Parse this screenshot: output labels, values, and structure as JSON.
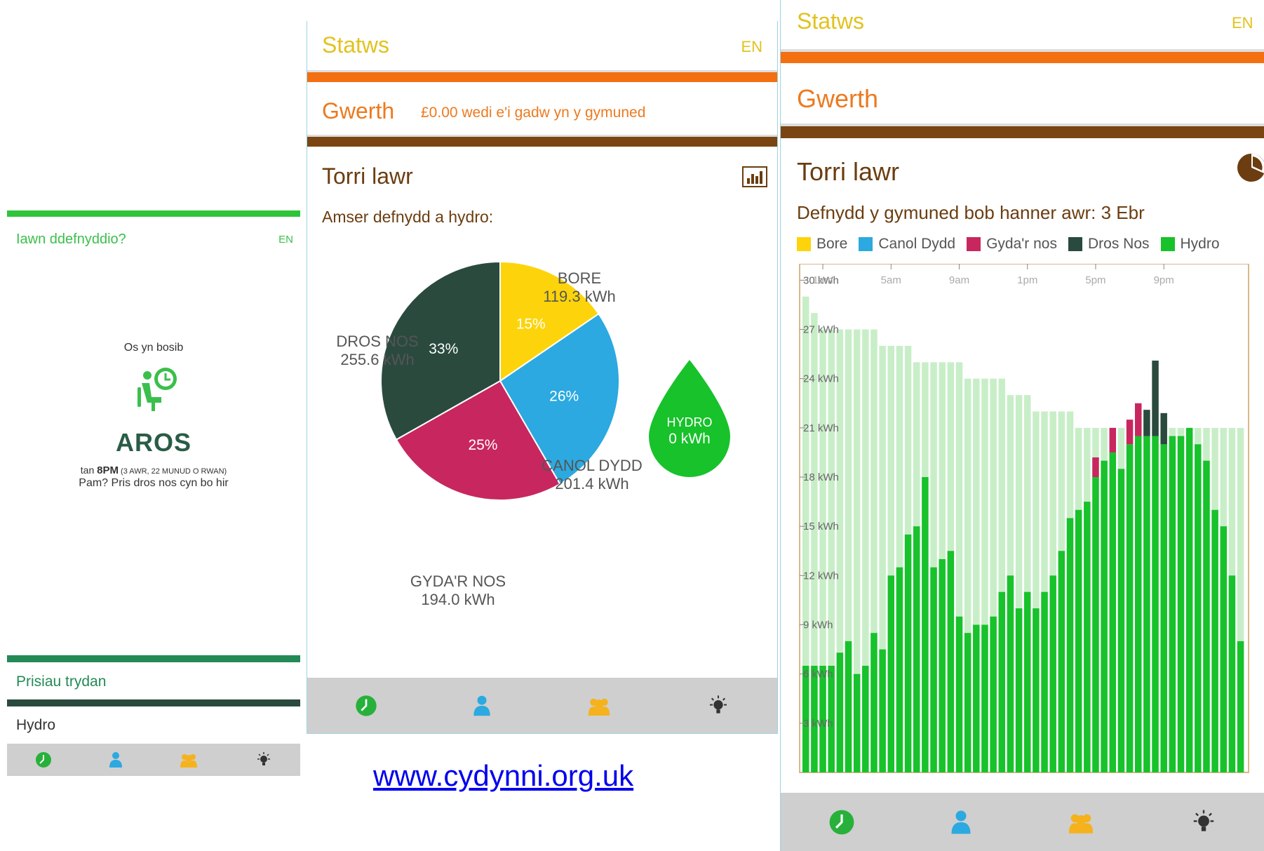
{
  "panel_left": {
    "title": "Iawn ddefnyddio?",
    "lang": "EN",
    "hint": "Os yn bosib",
    "status_word": "AROS",
    "until_prefix": "tan ",
    "until_time": "8PM",
    "until_detail": " (3 AWR, 22 MUNUD O RWAN)",
    "reason": "Pam? Pris dros nos cyn bo hir",
    "prices_label": "Prisiau trydan",
    "hydro_label": "Hydro"
  },
  "panel_middle": {
    "status_title": "Statws",
    "lang": "EN",
    "value_title": "Gwerth",
    "value_text": "£0.00 wedi e'i gadw yn y gymuned",
    "breakdown_title": "Torri lawr",
    "chart_subtitle": "Amser defnydd a hydro:"
  },
  "panel_right": {
    "status_title": "Statws",
    "lang": "EN",
    "value_title": "Gwerth",
    "breakdown_title": "Torri lawr",
    "chart_subtitle": "Defnydd y gymuned bob hanner awr: 3 Ebr"
  },
  "footer_link": "www.cydynni.org.uk",
  "colors": {
    "green": "#2ec53a",
    "yellow": "#e2c21e",
    "orange": "#f36f12",
    "orange_text": "#ec7a1f",
    "brown": "#7a4512",
    "bore": "#fdd40b",
    "canol_dydd": "#2ca9e0",
    "gyda_nos": "#c7275e",
    "dros_nos": "#2a4a3e",
    "hydro": "#17c22b",
    "hydro_light": "#c8eec8"
  },
  "icons": [
    "clock-icon",
    "person-icon",
    "community-icon",
    "lightbulb-icon"
  ],
  "chart_data": [
    {
      "type": "pie",
      "title": "Amser defnydd a hydro:",
      "slices": [
        {
          "name": "BORE",
          "value": 119.3,
          "unit": "kWh",
          "percent": "15%",
          "value_label": "119.3 kWh",
          "color": "#fdd40b"
        },
        {
          "name": "CANOL DYDD",
          "value": 201.4,
          "unit": "kWh",
          "percent": "26%",
          "value_label": "201.4 kWh",
          "color": "#2ca9e0"
        },
        {
          "name": "GYDA'R NOS",
          "value": 194.0,
          "unit": "kWh",
          "percent": "25%",
          "value_label": "194.0 kWh",
          "color": "#c7275e"
        },
        {
          "name": "DROS NOS",
          "value": 255.6,
          "unit": "kWh",
          "percent": "33%",
          "value_label": "255.6 kWh",
          "color": "#2a4a3e"
        }
      ],
      "hydro": {
        "label": "HYDRO",
        "value": 0,
        "value_label": "0 kWh"
      }
    },
    {
      "type": "bar",
      "title": "Defnydd y gymuned bob hanner awr: 3 Ebr",
      "legend": [
        "Bore",
        "Canol Dydd",
        "Gyda'r nos",
        "Dros Nos",
        "Hydro"
      ],
      "legend_colors": [
        "#fdd40b",
        "#2ca9e0",
        "#c7275e",
        "#2a4a3e",
        "#17c22b"
      ],
      "x_ticks": [
        "1am",
        "5am",
        "9am",
        "1pm",
        "5pm",
        "9pm"
      ],
      "y_ticks": [
        "3 kWh",
        "6 kWh",
        "9 kWh",
        "12 kWh",
        "15 kWh",
        "18 kWh",
        "21 kWh",
        "24 kWh",
        "27 kWh",
        "30 kWh"
      ],
      "ylim": [
        0,
        31
      ],
      "series": [
        {
          "name": "Hydro",
          "values": [
            6.5,
            6.5,
            6.5,
            6.5,
            7.3,
            8,
            6,
            6.5,
            8.5,
            7.5,
            12,
            12.5,
            14.5,
            15,
            18,
            12.5,
            13,
            13.5,
            9.5,
            8.5,
            9,
            9,
            9.5,
            11,
            12,
            10,
            11,
            10,
            11,
            12,
            13.5,
            15.5,
            16,
            16.5,
            18,
            19,
            19.5,
            18.5,
            20,
            20.5,
            20.5,
            20.5,
            20,
            20.5,
            20.5,
            21,
            20,
            19,
            16,
            15,
            12,
            8
          ]
        },
        {
          "name": "Gyda'r nos",
          "values": [
            0,
            0,
            0,
            0,
            0,
            0,
            0,
            0,
            0,
            0,
            0,
            0,
            0,
            0,
            0,
            0,
            0,
            0,
            0,
            0,
            0,
            0,
            0,
            0,
            0,
            0,
            0,
            0,
            0,
            0,
            0,
            0,
            0,
            0,
            1.2,
            0,
            1.5,
            0,
            1.5,
            2,
            0,
            0,
            0,
            0,
            0,
            0,
            0,
            0,
            0,
            0,
            0,
            0
          ]
        },
        {
          "name": "Dros Nos",
          "values": [
            0,
            0,
            0,
            0,
            0,
            0,
            0,
            0,
            0,
            0,
            0,
            0,
            0,
            0,
            0,
            0,
            0,
            0,
            0,
            0,
            0,
            0,
            0,
            0,
            0,
            0,
            0,
            0,
            0,
            0,
            0,
            0,
            0,
            0,
            0,
            0,
            0,
            0,
            0,
            0,
            1.6,
            4.6,
            1.9,
            0,
            0,
            0,
            0,
            0,
            0,
            0,
            0,
            0
          ]
        },
        {
          "name": "Hydro available",
          "values": [
            29,
            28,
            27,
            27,
            27,
            27,
            27,
            27,
            27,
            26,
            26,
            26,
            26,
            25,
            25,
            25,
            25,
            25,
            25,
            24,
            24,
            24,
            24,
            24,
            23,
            23,
            23,
            22,
            22,
            22,
            22,
            22,
            21,
            21,
            21,
            21,
            21,
            21,
            21,
            21,
            21,
            21,
            21,
            21,
            21,
            21,
            21,
            21,
            21,
            21,
            21,
            21
          ]
        }
      ]
    }
  ]
}
